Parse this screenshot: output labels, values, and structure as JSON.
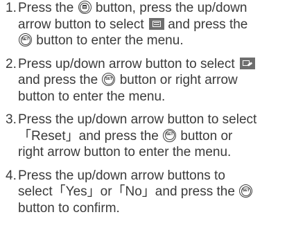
{
  "steps": [
    {
      "number": "1.",
      "lines": [
        [
          "Press the",
          "button, press the up/down"
        ],
        [
          "arrow button to select",
          "and press the"
        ],
        [
          "",
          "button to enter the menu."
        ]
      ]
    },
    {
      "number": "2.",
      "lines": [
        [
          "Press up/down arrow button to select"
        ],
        [
          "and press the",
          "button or right arrow"
        ],
        [
          "button to enter the menu."
        ]
      ]
    },
    {
      "number": "3.",
      "lines": [
        [
          "Press the up/down arrow button to select"
        ],
        [
          "「Reset」and press the",
          "button or"
        ],
        [
          "right arrow button to enter the menu."
        ]
      ]
    },
    {
      "number": "4.",
      "lines": [
        [
          "Press the up/down arrow buttons to"
        ],
        [
          "select「Yes」or「No」and press the"
        ],
        [
          "button to confirm."
        ]
      ]
    }
  ],
  "icons": {
    "menu_button": "menu-button-icon",
    "set_button": "set-button-icon",
    "set_button_label": "SET",
    "setting_tab": "setting-menu-icon",
    "tools_tab": "tools-menu-icon"
  }
}
